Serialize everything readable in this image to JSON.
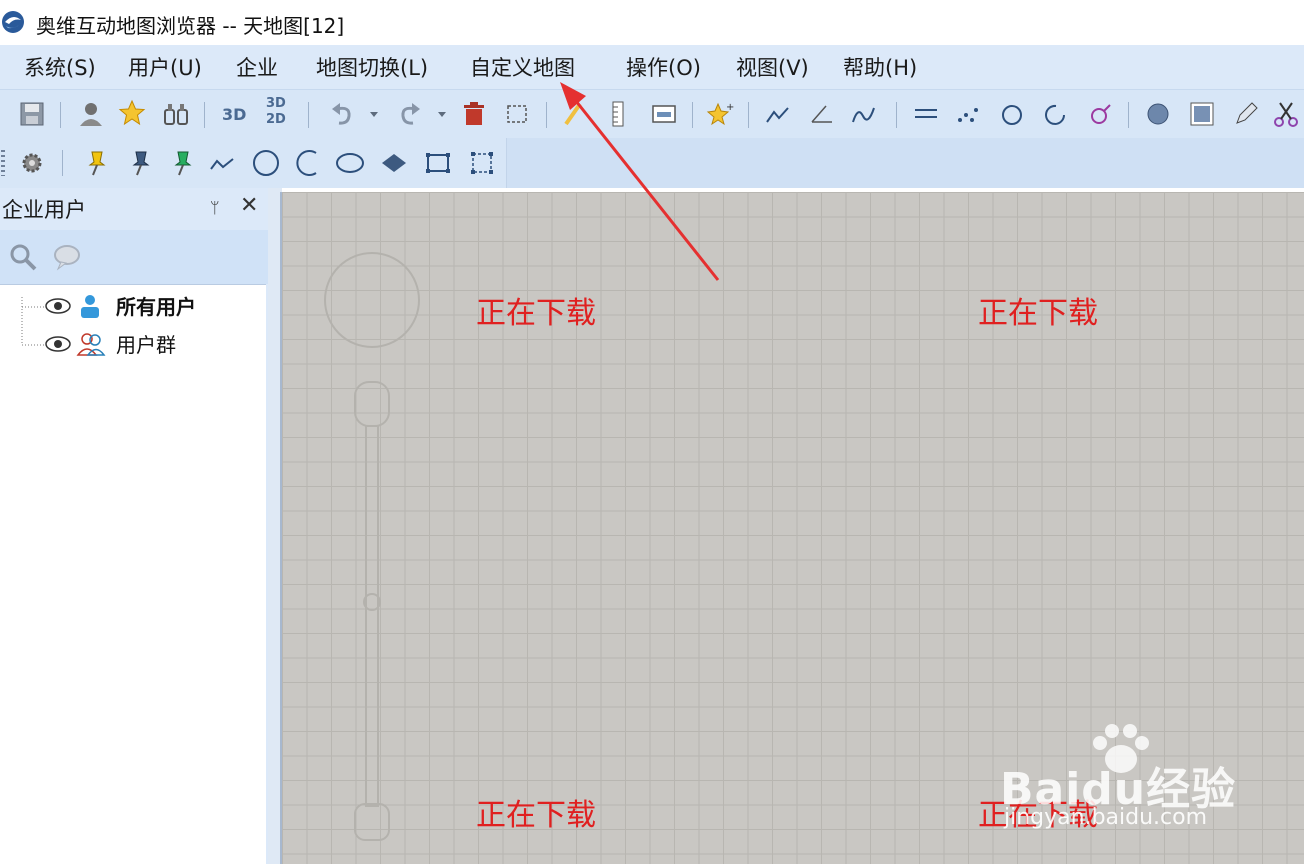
{
  "window": {
    "title": "奥维互动地图浏览器 -- 天地图[12]"
  },
  "menu": {
    "system": "系统(S)",
    "user": "用户(U)",
    "enterprise": "企业",
    "map_switch": "地图切换(L)",
    "custom_map": "自定义地图",
    "operation": "操作(O)",
    "view": "视图(V)",
    "help": "帮助(H)"
  },
  "toolbar": {
    "label_3d": "3D",
    "label_3d_top": "3D",
    "label_2d_bottom": "2D"
  },
  "panel": {
    "title": "企业用户",
    "pin": "ᛘ",
    "close": "✕",
    "tree": [
      {
        "label": "所有用户"
      },
      {
        "label": "用户群"
      }
    ]
  },
  "map": {
    "tiles": [
      "正在下载",
      "正在下载",
      "正在下载",
      "正在下载"
    ]
  },
  "watermark": {
    "text": "Baidu经验",
    "sub": "jingyan.baidu.com"
  },
  "colors": {
    "menu_bg": "#dce9f9",
    "toolbar_bg": "#d7e6f7",
    "map_bg": "#c9c7c3",
    "annotation": "#e02020"
  },
  "icons": [
    "save-icon",
    "user-icon",
    "star-icon",
    "binoculars-icon",
    "3d-icon",
    "3d-2d-icon",
    "undo-icon",
    "redo-icon",
    "delete-icon",
    "select-rect-icon",
    "ruler-icon",
    "measure-icon",
    "sparkle-icon",
    "line-add-icon",
    "angle-icon",
    "curve-icon",
    "parallel-icon",
    "dots-icon",
    "rotate-icon",
    "refresh-icon",
    "female-icon",
    "globe-icon",
    "grid-icon",
    "pencil-icon",
    "scissors-icon",
    "gear-icon",
    "pin-yellow-icon",
    "pin-blue-icon",
    "pin-green-icon",
    "polyline-icon",
    "circle-icon",
    "arc-icon",
    "ellipse-icon",
    "diamond-icon",
    "rect-icon",
    "select-icon",
    "search-icon",
    "chat-icon",
    "eye-icon",
    "users-icon"
  ]
}
